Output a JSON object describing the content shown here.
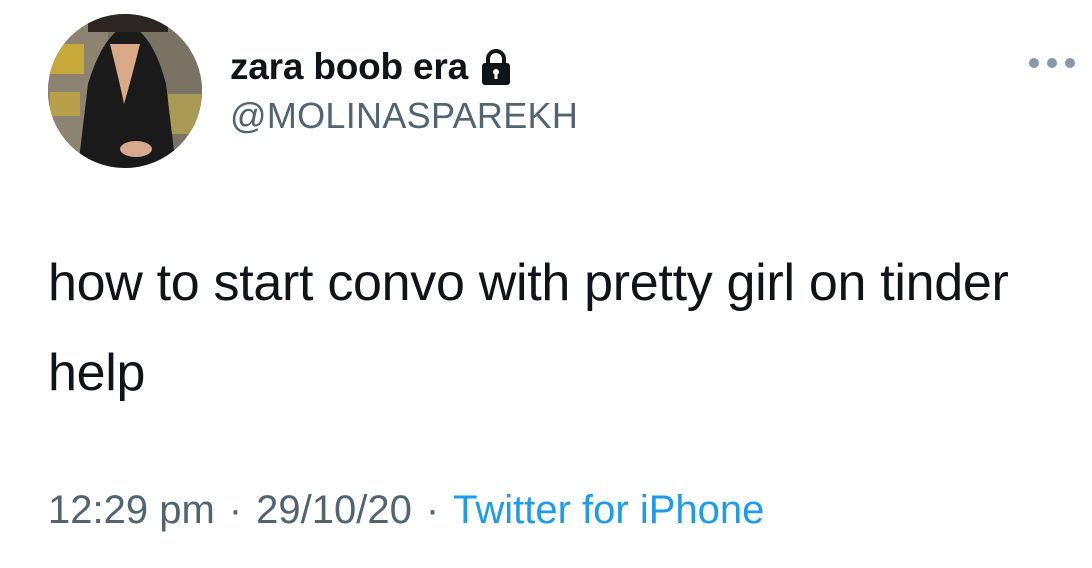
{
  "user": {
    "display_name": "zara boob era",
    "handle": "@MOLINASPAREKH",
    "avatar_icon": "profile-photo",
    "protected_icon": "lock-icon"
  },
  "tweet": {
    "text": "how to start convo with pretty girl on tinder help"
  },
  "meta": {
    "time": "12:29 pm",
    "separator": "·",
    "date": "29/10/20",
    "source": "Twitter for iPhone"
  },
  "menu": {
    "icon": "more-options-icon"
  },
  "colors": {
    "text": "#0f1419",
    "secondary": "#536471",
    "link": "#1d9bf0",
    "background": "#ffffff"
  }
}
